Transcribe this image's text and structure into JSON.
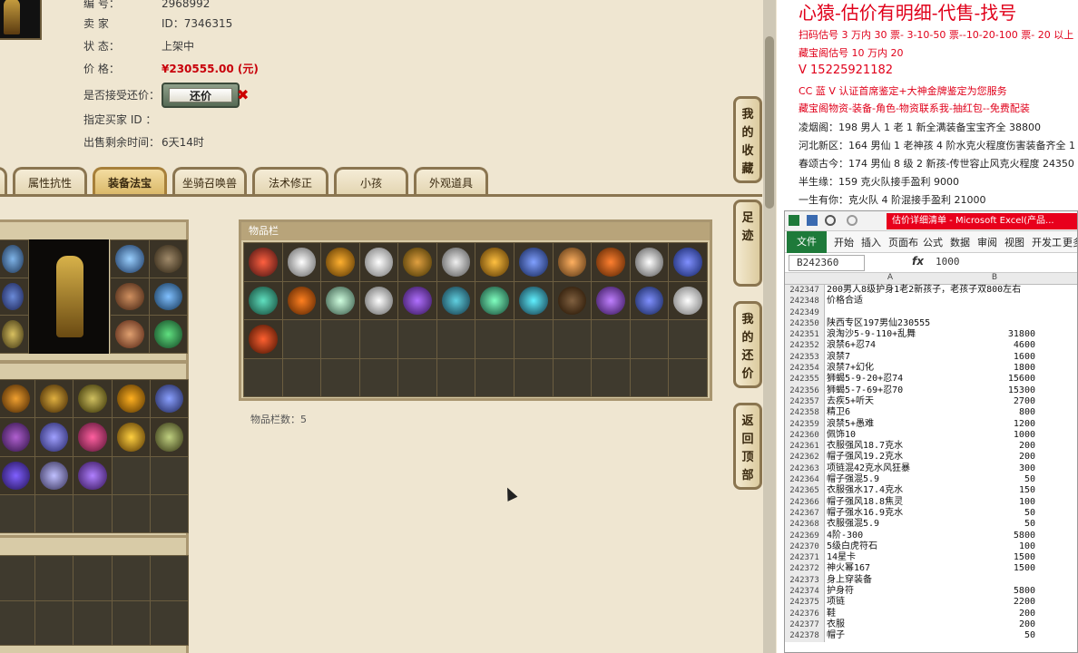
{
  "listing": {
    "id_label": "编 号：",
    "id_value": "2968992",
    "seller_label": "卖 家",
    "seller_value": "ID：7346315",
    "status_label": "状 态：",
    "status_value": "上架中",
    "price_label": "价 格：",
    "price_value": "¥230555.00 (元)",
    "counter_label": "是否接受还价：",
    "counter_button": "还价",
    "buyer_label": "指定买家 ID ：",
    "time_label": "出售剩余时间：",
    "time_value": "6天14时"
  },
  "tabs": [
    "属性抗性",
    "装备法宝",
    "坐骑召唤兽",
    "法术修正",
    "小孩",
    "外观道具"
  ],
  "active_tab": "装备法宝",
  "inventory": {
    "title": "物品栏",
    "count_label": "物品栏数：5"
  },
  "side_buttons": [
    "我的收藏",
    "足迹",
    "我的还价",
    "返回顶部"
  ],
  "overlay": {
    "title": "心猿-估价有明细-代售-找号",
    "lines": [
      {
        "text": "扫码估号 3 万内 30 票- 3-10-50 票--10-20-100 票- 20 以上 150",
        "red": true
      },
      {
        "text": "藏宝阁估号 10 万内 20",
        "red": true
      },
      {
        "text": "V 15225921182",
        "red": true
      },
      {
        "text": "CC 蓝 V 认证首席鉴定+大神金牌鉴定为您服务",
        "red": true
      },
      {
        "text": "藏宝阁物资-装备-角色-物资联系我-抽红包--免费配装",
        "red": true
      },
      {
        "text": "凌烟阁：198 男人 1 老 1 新全满装备宝宝齐全 38800",
        "red": false
      },
      {
        "text": "河北新区：164 男仙 1 老神孩 4 阶水克火程度伤害装备齐全 1",
        "red": false
      },
      {
        "text": "春颂古今：174 男仙 8 级 2 新孩-传世容止风克火程度 24350",
        "red": false
      },
      {
        "text": "半生缘：159 克火队接手盈利 9000",
        "red": false
      },
      {
        "text": "一生有你：克火队 4 阶混接手盈利 21000",
        "red": false
      }
    ]
  },
  "excel": {
    "title": "估价详细清单 - Microsoft Excel(产品...",
    "file_tab": "文件",
    "ribbon_tabs": [
      "开始",
      "插入",
      "页面布",
      "公式",
      "数据",
      "审阅",
      "视图",
      "开发工",
      "更多"
    ],
    "name_box": "B242360",
    "fx": "fx",
    "formula_value": "1000",
    "col_a": "A",
    "col_b": "B",
    "rows": [
      {
        "n": "242347",
        "a": "200男人8级护身1老2新孩子，老孩子双800左右",
        "b": ""
      },
      {
        "n": "242348",
        "a": "价格合适",
        "b": ""
      },
      {
        "n": "242349",
        "a": "",
        "b": ""
      },
      {
        "n": "242350",
        "a": "陕西专区197男仙230555",
        "b": ""
      },
      {
        "n": "242351",
        "a": "浪淘沙5-9-110+乱舞",
        "b": "31800"
      },
      {
        "n": "242352",
        "a": "浪禁6+忍74",
        "b": "4600"
      },
      {
        "n": "242353",
        "a": "浪禁7",
        "b": "1600"
      },
      {
        "n": "242354",
        "a": "浪禁7+幻化",
        "b": "1800"
      },
      {
        "n": "242355",
        "a": "狮蝎5-9-20+忍74",
        "b": "15600"
      },
      {
        "n": "242356",
        "a": "狮蝎5-7-69+忍70",
        "b": "15300"
      },
      {
        "n": "242357",
        "a": "去疾5+听天",
        "b": "2700"
      },
      {
        "n": "242358",
        "a": "精卫6",
        "b": "800"
      },
      {
        "n": "242359",
        "a": "浪禁5+愚难",
        "b": "1200"
      },
      {
        "n": "242360",
        "a": "佩饰10",
        "b": "1000"
      },
      {
        "n": "242361",
        "a": "衣服强风18.7克水",
        "b": "200"
      },
      {
        "n": "242362",
        "a": "帽子强风19.2克水",
        "b": "200"
      },
      {
        "n": "242363",
        "a": "项链混42克水风狂暴",
        "b": "300"
      },
      {
        "n": "242364",
        "a": "帽子强混5.9",
        "b": "50"
      },
      {
        "n": "242365",
        "a": "衣服强水17.4克水",
        "b": "150"
      },
      {
        "n": "242366",
        "a": "帽子强风18.8焦灵",
        "b": "100"
      },
      {
        "n": "242367",
        "a": "帽子强水16.9克水",
        "b": "50"
      },
      {
        "n": "242368",
        "a": "衣服强混5.9",
        "b": "50"
      },
      {
        "n": "242369",
        "a": "4阶-300",
        "b": "5800"
      },
      {
        "n": "242370",
        "a": "5级白虎符石",
        "b": "100"
      },
      {
        "n": "242371",
        "a": "14星卡",
        "b": "1500"
      },
      {
        "n": "242372",
        "a": "神火幂167",
        "b": "1500"
      },
      {
        "n": "242373",
        "a": "身上穿装备",
        "b": ""
      },
      {
        "n": "242374",
        "a": "护身符",
        "b": "5800"
      },
      {
        "n": "242375",
        "a": "项链",
        "b": "2200"
      },
      {
        "n": "242376",
        "a": "鞋",
        "b": "200"
      },
      {
        "n": "242377",
        "a": "衣服",
        "b": "200"
      },
      {
        "n": "242378",
        "a": "帽子",
        "b": "50"
      }
    ]
  },
  "colors": {
    "price": "#c8000a",
    "banner_red": "#e0001a",
    "excel_green": "#1e7a3a"
  }
}
